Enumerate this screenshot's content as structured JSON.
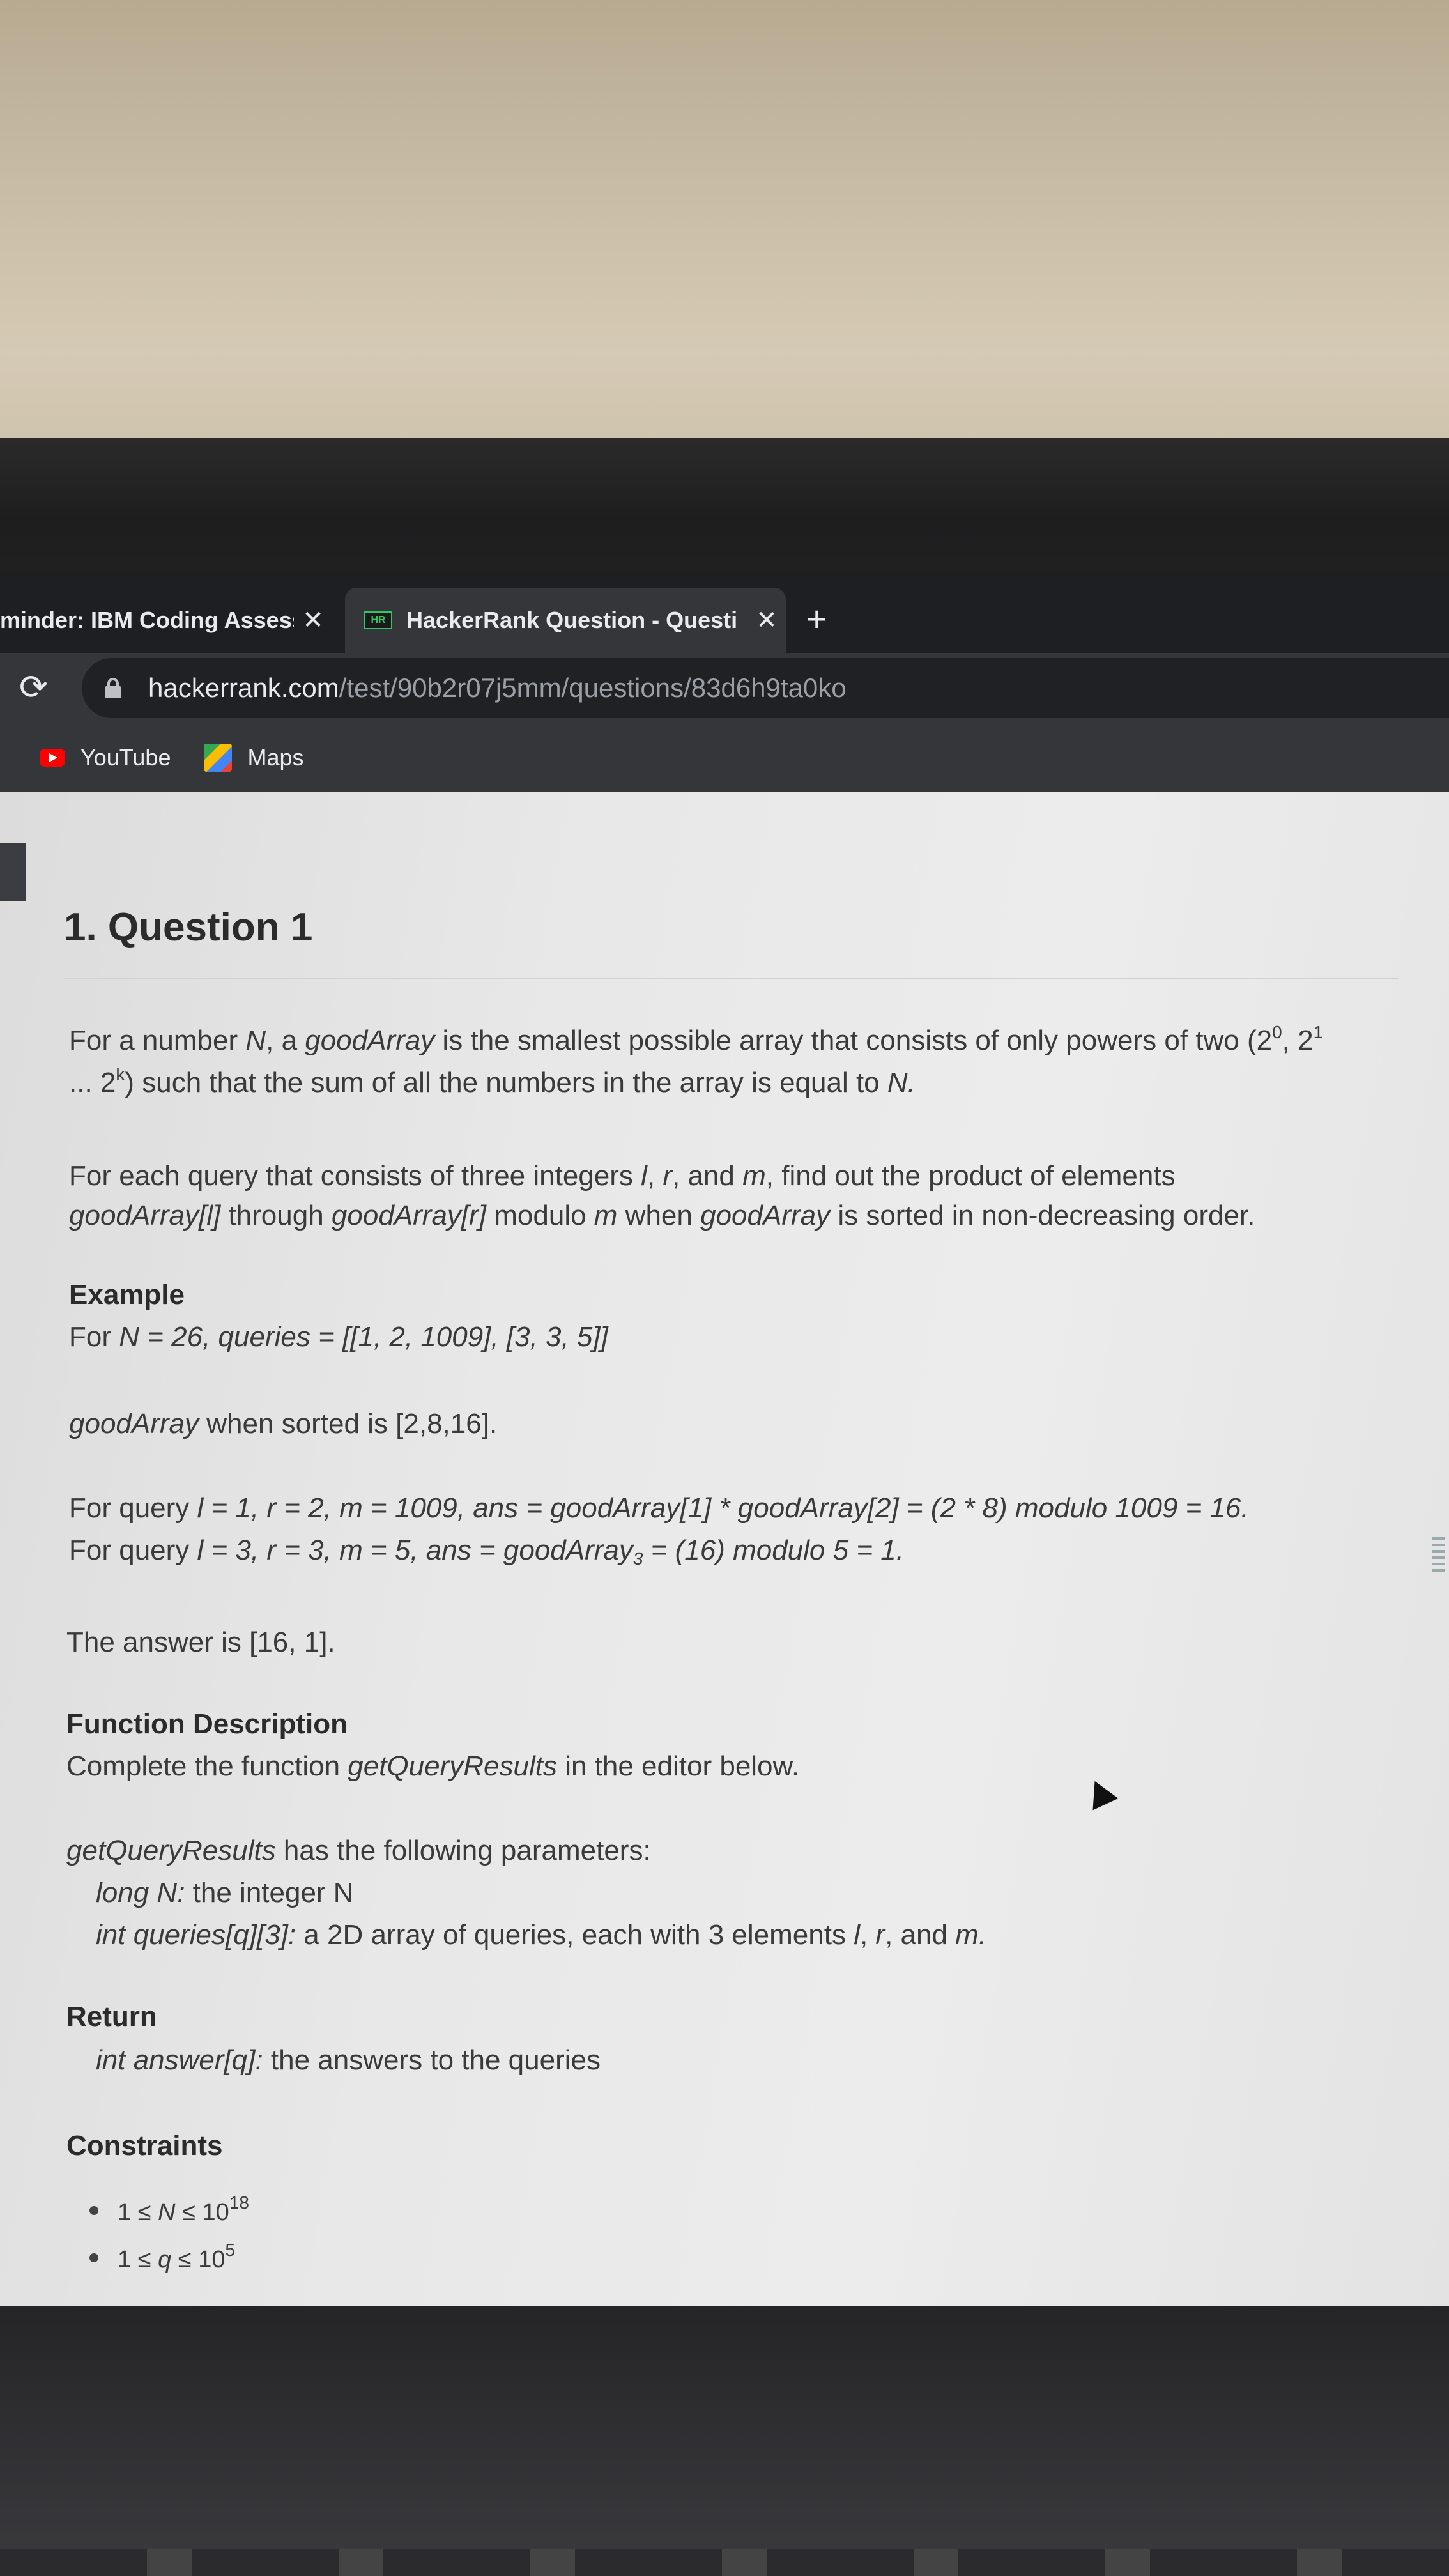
{
  "browser": {
    "tabs": [
      {
        "title": "minder: IBM Coding Assess",
        "close": "✕"
      },
      {
        "icon_text": "HR",
        "title": "HackerRank Question - Questi",
        "close": "✕"
      }
    ],
    "new_tab": "+",
    "reload_icon": "⟳",
    "url_host": "hackerrank.com",
    "url_path": "/test/90b2r07j5mm/questions/83d6h9ta0ko",
    "bookmarks": [
      {
        "label": "YouTube",
        "icon": "youtube-icon"
      },
      {
        "label": "Maps",
        "icon": "maps-icon"
      }
    ]
  },
  "question": {
    "title": "1. Question 1",
    "intro": {
      "p1": "For a number ",
      "N": "N",
      "p2": ", a ",
      "goodArray": "goodArray",
      "p3": " is the smallest possible array that consists of only powers of two (2",
      "exp0": "0",
      "p4": ", 2",
      "exp1": "1",
      "line2a": "... 2",
      "expk": "k",
      "line2b": ") such that the sum of all the numbers in the array is equal to ",
      "N2": "N.",
      "q1": "For each query that consists of three integers ",
      "l": "l",
      "comma1": ", ",
      "r": "r",
      "and": ", and ",
      "m": "m",
      "q2": ", find out the product of elements",
      "ga_l": "goodArray[l]",
      "through": " through ",
      "ga_r": "goodArray[r]",
      "modulo": " modulo ",
      "m2": "m",
      "when": " when ",
      "ga": "goodArray",
      "sorted": " is sorted in non-decreasing order."
    },
    "example": {
      "heading": "Example",
      "for": "For ",
      "def": "N = 26, queries = [[1, 2, 1009], [3, 3, 5]]",
      "sorted_ga": "goodArray",
      "sorted_text": " when sorted is [2,8,16].",
      "q1_lead": "For query ",
      "q1_math": "l = 1, r = 2, m = 1009, ans = goodArray[1] * goodArray[2] = (2 * 8) modulo 1009 = 16.",
      "q2_lead": "For query ",
      "q2_math_a": "l = 3, r = 3, m = 5, ans = goodArray",
      "q2_sub": "3",
      "q2_math_b": " = (16) modulo 5 = 1.",
      "answer": "The answer is [16, 1]."
    },
    "function_description": {
      "heading": "Function Description",
      "lead": "Complete the function ",
      "fname": "getQueryResults",
      "tail": " in the editor below.",
      "params_fname": "getQueryResults",
      "params_tail": " has the following parameters:",
      "param1_name": "long N:",
      "param1_desc": " the integer N",
      "param2_name": "int queries[q][3]:",
      "param2_desc_a": "  a 2D array of queries, each with 3 elements ",
      "param2_l": "l",
      "param2_comma": ", ",
      "param2_r": "r",
      "param2_and": ", and ",
      "param2_m": "m."
    },
    "return": {
      "heading": "Return",
      "name": "int answer[q]:",
      "desc": " the answers to the queries"
    },
    "constraints": {
      "heading": "Constraints",
      "c1_a": "1 ≤ ",
      "c1_var": "N",
      "c1_b": " ≤ 10",
      "c1_exp": "18",
      "c2_a": "1 ≤ ",
      "c2_var": "q",
      "c2_b": " ≤ 10",
      "c2_exp": "5"
    }
  }
}
